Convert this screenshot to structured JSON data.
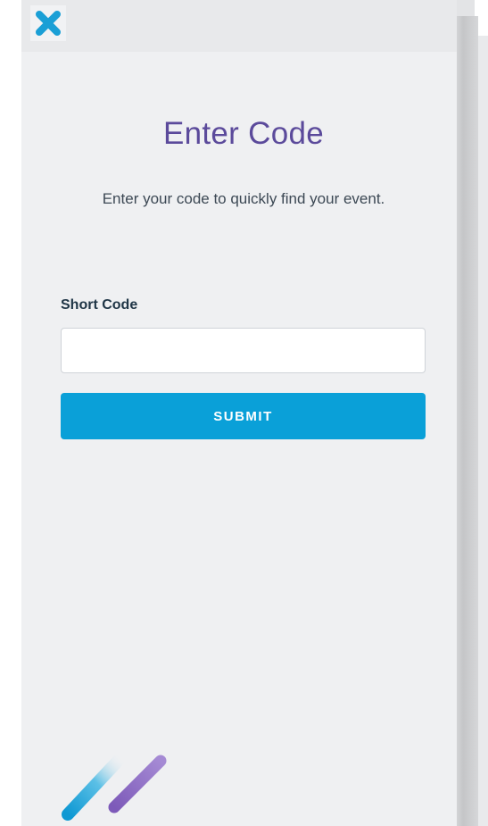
{
  "header": {
    "close_icon": "close-icon"
  },
  "main": {
    "title": "Enter Code",
    "subtitle": "Enter your code to quickly find your event."
  },
  "form": {
    "field_label": "Short Code",
    "input_value": "",
    "input_placeholder": "",
    "submit_label": "SUBMIT"
  },
  "footer": {
    "logo_icon": "brand-stripes-logo"
  },
  "colors": {
    "accent": "#0aa0d8",
    "title": "#5b4a9b",
    "close_icon": "#1a9fd6",
    "logo_blue": "#1fa2d8",
    "logo_purple": "#8f6cc4"
  }
}
